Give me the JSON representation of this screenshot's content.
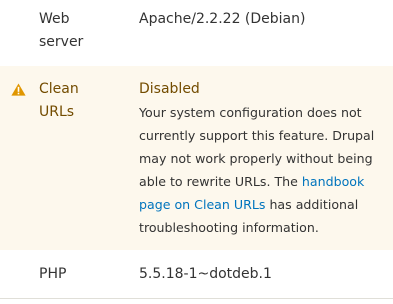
{
  "rows": [
    {
      "title": "Web server",
      "title_lines": [
        "Web",
        "server"
      ],
      "value": "Apache/2.2.22 (Debian)"
    },
    {
      "title": "Clean URLs",
      "title_lines": [
        "Clean",
        "URLs"
      ],
      "status": "Disabled",
      "severity": "warning",
      "icon": "warning-icon",
      "description": {
        "text_before": "Your system configuration does not currently support this feature. Drupal may not work properly without being able to rewrite URLs. The ",
        "link_text": "handbook page on Clean URLs",
        "text_after": " has additional troubleshooting information."
      }
    },
    {
      "title": "PHP",
      "value": "5.5.18-1~dotdeb.1"
    }
  ],
  "colors": {
    "warning_background": "#fdf8ed",
    "warning_text": "#734c00",
    "warning_icon": "#e09600",
    "link": "#0074bd",
    "divider": "#e0dfd8"
  }
}
